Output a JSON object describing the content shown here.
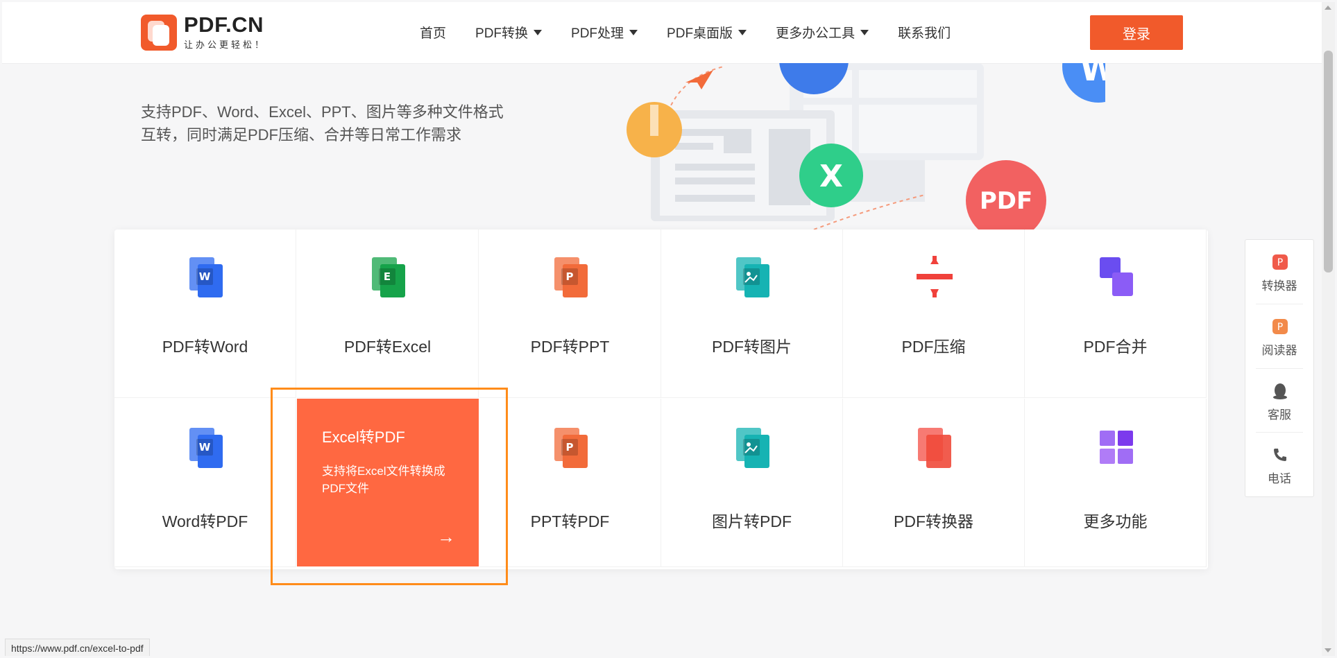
{
  "header": {
    "logo_name": "PDF.CN",
    "logo_slogan": "让办公更轻松！",
    "nav": [
      {
        "label": "首页",
        "dropdown": false
      },
      {
        "label": "PDF转换",
        "dropdown": true
      },
      {
        "label": "PDF处理",
        "dropdown": true
      },
      {
        "label": "PDF桌面版",
        "dropdown": true
      },
      {
        "label": "更多办公工具",
        "dropdown": true
      },
      {
        "label": "联系我们",
        "dropdown": false
      }
    ],
    "login_label": "登录"
  },
  "hero": {
    "line1": "支持PDF、Word、Excel、PPT、图片等多种文件格式",
    "line2": "互转，同时满足PDF压缩、合并等日常工作需求",
    "bubble_x": "X",
    "bubble_pdf": "PDF",
    "bubble_w": "W"
  },
  "tools_row1": [
    {
      "label": "PDF转Word",
      "icon": "word-icon",
      "icon_text": "W",
      "color": "#2f6bf0"
    },
    {
      "label": "PDF转Excel",
      "icon": "excel-icon",
      "icon_text": "E",
      "color": "#16a34a"
    },
    {
      "label": "PDF转PPT",
      "icon": "ppt-icon",
      "icon_text": "P",
      "color": "#f26b3a"
    },
    {
      "label": "PDF转图片",
      "icon": "image-icon",
      "icon_text": "",
      "color": "#16b3b3"
    },
    {
      "label": "PDF压缩",
      "icon": "compress-icon",
      "icon_text": "",
      "color": "#f0413b"
    },
    {
      "label": "PDF合并",
      "icon": "merge-icon",
      "icon_text": "",
      "color": "#7c4df0"
    }
  ],
  "tools_row2": [
    {
      "label": "Word转PDF",
      "icon": "word-icon",
      "icon_text": "W",
      "color": "#2f6bf0"
    },
    {
      "label": "Excel转PDF",
      "icon": "excel-icon",
      "icon_text": "E",
      "color": "#16a34a"
    },
    {
      "label": "PPT转PDF",
      "icon": "ppt-icon",
      "icon_text": "P",
      "color": "#f26b3a"
    },
    {
      "label": "图片转PDF",
      "icon": "image-icon",
      "icon_text": "",
      "color": "#16b3b3"
    },
    {
      "label": "PDF转换器",
      "icon": "converter-icon",
      "icon_text": "",
      "color": "#f0413b"
    },
    {
      "label": "更多功能",
      "icon": "more-grid-icon",
      "icon_text": "",
      "color": "#9b5cf0"
    }
  ],
  "hover_card": {
    "title": "Excel转PDF",
    "desc": "支持将Excel文件转换成PDF文件",
    "arrow": "→",
    "color": "#ff6841"
  },
  "sidebar": [
    {
      "label": "转换器",
      "icon": "converter-app-icon"
    },
    {
      "label": "阅读器",
      "icon": "reader-app-icon"
    },
    {
      "label": "客服",
      "icon": "qq-service-icon"
    },
    {
      "label": "电话",
      "icon": "phone-icon"
    }
  ],
  "status_url": "https://www.pdf.cn/excel-to-pdf",
  "colors": {
    "accent": "#f15a2b",
    "highlight": "#ff8c1a"
  }
}
